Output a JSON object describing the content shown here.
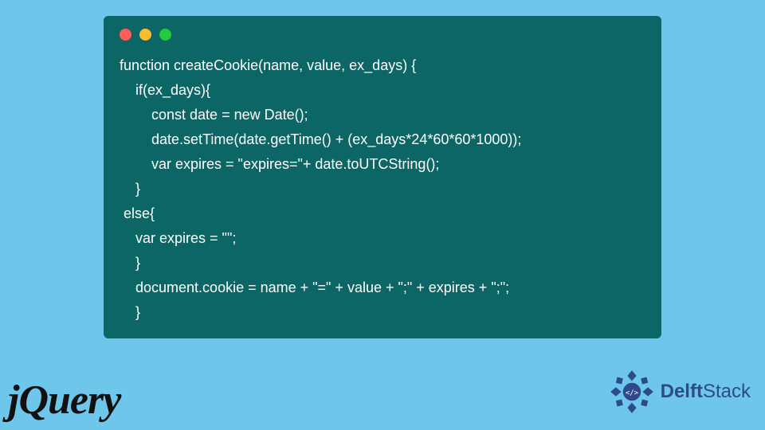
{
  "code": {
    "lines": [
      "function createCookie(name, value, ex_days) {",
      "    if(ex_days){",
      "        const date = new Date();",
      "        date.setTime(date.getTime() + (ex_days*24*60*60*1000));",
      "        var expires = \"expires=\"+ date.toUTCString();",
      "    }",
      " else{",
      "    var expires = \"\";",
      "    }",
      "    document.cookie = name + \"=\" + value + \";\" + expires + \";\";",
      "    }"
    ]
  },
  "brand_left": "jQuery",
  "brand_right": {
    "prefix": "Delft",
    "suffix": "Stack"
  },
  "colors": {
    "page_bg": "#6ec7eb",
    "window_bg": "#0b6665",
    "dot_red": "#ff5f56",
    "dot_yellow": "#ffbd2e",
    "dot_green": "#27c93f",
    "delft_blue": "#2d4a8a"
  }
}
